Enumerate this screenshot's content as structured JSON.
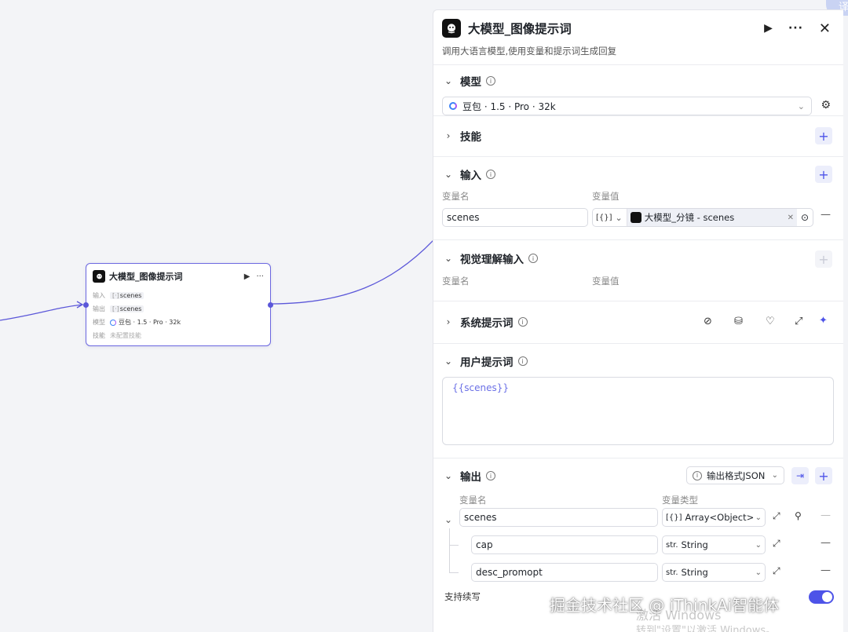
{
  "node": {
    "title": "大模型_图像提示词",
    "run_icon": "▶",
    "more_icon": "···",
    "rows": [
      {
        "key": "输入",
        "type": "[·]",
        "value": "scenes"
      },
      {
        "key": "输出",
        "type": "[·]",
        "value": "scenes"
      },
      {
        "key": "模型",
        "value": "豆包 · 1.5 · Pro · 32k"
      },
      {
        "key": "技能",
        "value": "未配置技能"
      }
    ]
  },
  "panel": {
    "title": "大模型_图像提示词",
    "description": "调用大语言模型,使用变量和提示词生成回复",
    "model": {
      "title": "模型",
      "selected": "豆包 · 1.5 · Pro · 32k"
    },
    "skills": {
      "title": "技能"
    },
    "input": {
      "title": "输入",
      "col_name": "变量名",
      "col_value": "变量值",
      "var_name": "scenes",
      "type_token": "[{}]",
      "ref_label": "大模型_分镜 - scenes"
    },
    "vision": {
      "title": "视觉理解输入",
      "col_name": "变量名",
      "col_value": "变量值"
    },
    "system_prompt": {
      "title": "系统提示词"
    },
    "user_prompt": {
      "title": "用户提示词",
      "content": "{{scenes}}"
    },
    "output": {
      "title": "输出",
      "format_label": "输出格式JSON",
      "col_name": "变量名",
      "col_type": "变量类型",
      "rows": [
        {
          "name": "scenes",
          "type_token": "[{}]",
          "type": "Array<Object>"
        },
        {
          "name": "cap",
          "type_token": "str.",
          "type": "String"
        },
        {
          "name": "desc_promopt",
          "type_token": "str.",
          "type": "String"
        }
      ],
      "streaming_label": "支持续写"
    }
  },
  "overlay": {
    "watermark": "掘金技术社区 @ iThinkAi智能体",
    "windows_line1": "激活 Windows",
    "windows_line2": "转到\"设置\"以激活 Windows。",
    "corner_tab": "译"
  },
  "colors": {
    "accent": "#4d53e8",
    "edge": "#5b57d9",
    "node_border": "#6b67e0"
  }
}
